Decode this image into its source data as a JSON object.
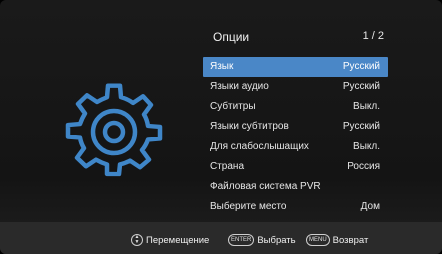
{
  "menu": {
    "title": "Опции",
    "page": "1 / 2",
    "items": [
      {
        "label": "Язык",
        "value": "Русский",
        "selected": true
      },
      {
        "label": "Языки аудио",
        "value": "Русский",
        "selected": false
      },
      {
        "label": "Субтитры",
        "value": "Выкл.",
        "selected": false
      },
      {
        "label": "Языки субтитров",
        "value": "Русский",
        "selected": false
      },
      {
        "label": "Для слабослышащих",
        "value": "Выкл.",
        "selected": false
      },
      {
        "label": "Страна",
        "value": "Россия",
        "selected": false
      },
      {
        "label": "Файловая система PVR",
        "value": "",
        "selected": false
      },
      {
        "label": "Выберите место",
        "value": "Дом",
        "selected": false
      }
    ]
  },
  "footer": {
    "nav_label": "Перемещение",
    "enter_key": "ENTER",
    "enter_label": "Выбрать",
    "menu_key": "MENU",
    "menu_label": "Возврат"
  },
  "colors": {
    "accent": "#4a87c7",
    "gear": "#3f86c8"
  },
  "icons": {
    "settings": "gear-icon",
    "navigation": "navigation-arrows-icon"
  }
}
